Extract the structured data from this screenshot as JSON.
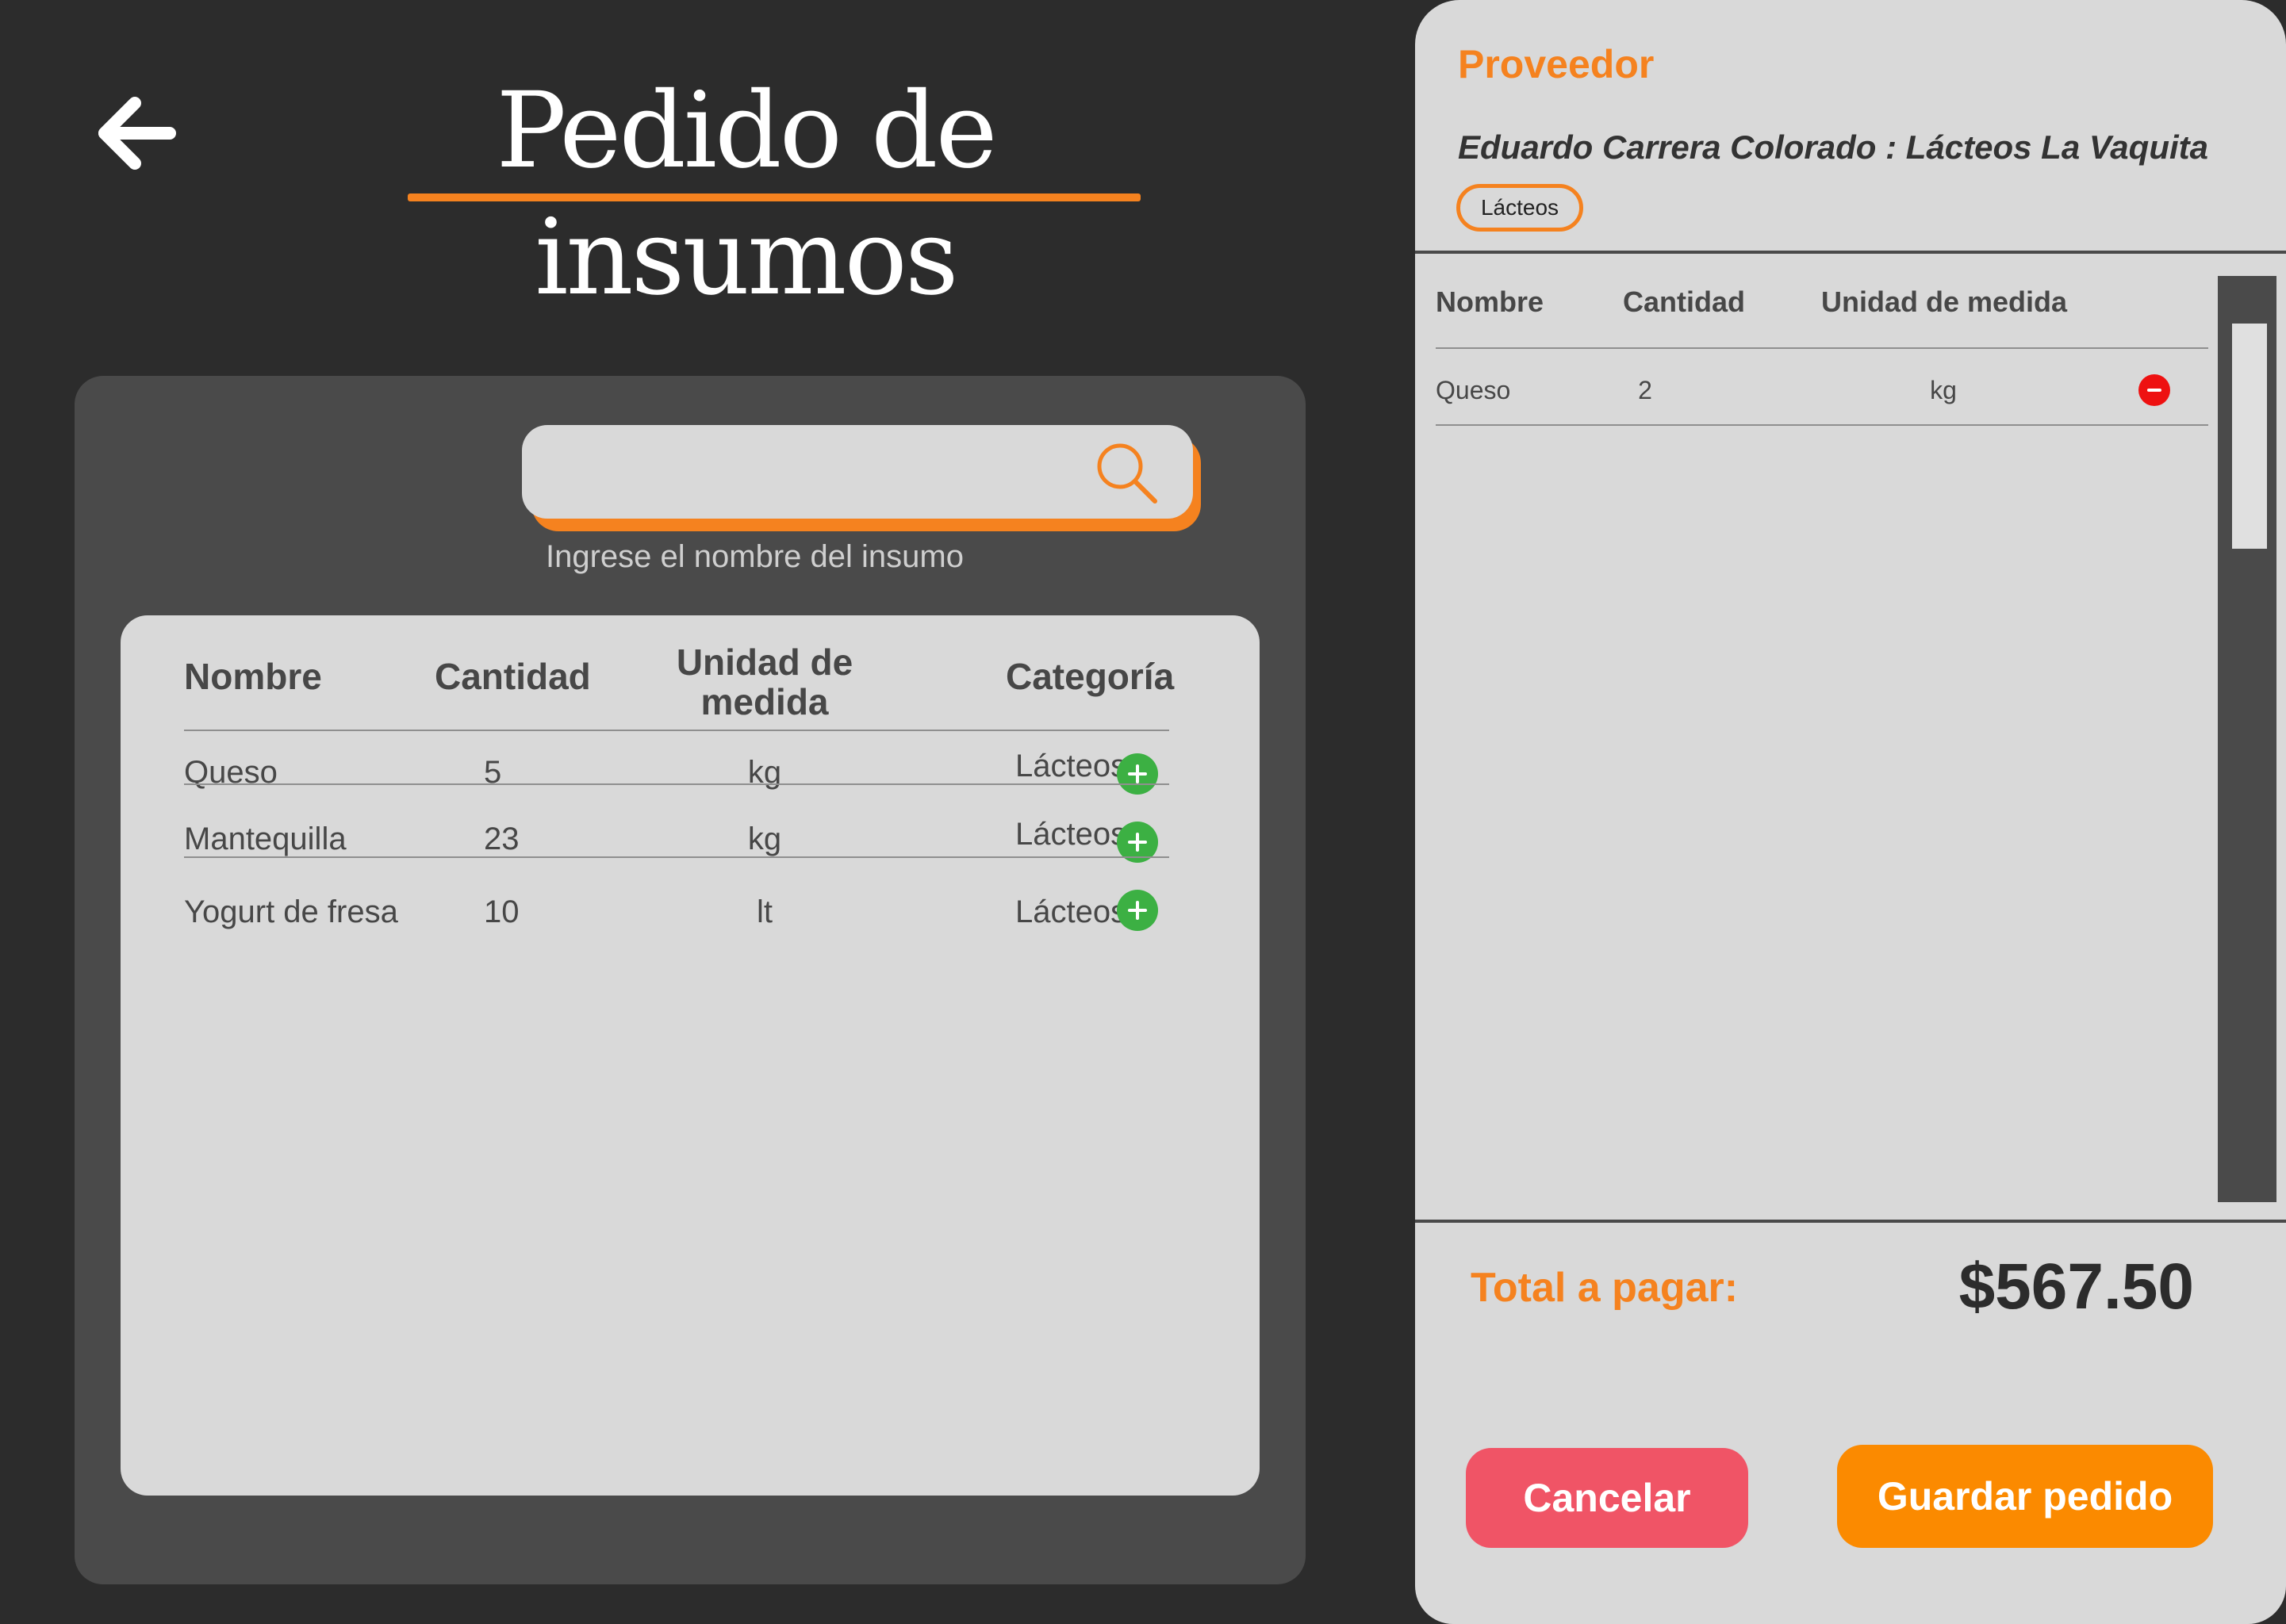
{
  "page": {
    "title": "Pedido de insumos"
  },
  "search": {
    "value": "",
    "placeholder": "",
    "hint": "Ingrese el nombre del insumo"
  },
  "inventory_table": {
    "headers": {
      "nombre": "Nombre",
      "cantidad": "Cantidad",
      "unidad_line1": "Unidad de",
      "unidad_line2": "medida",
      "categoria": "Categoría"
    },
    "rows": [
      {
        "nombre": "Queso",
        "cantidad": "5",
        "unidad": "kg",
        "categoria": "Lácteos"
      },
      {
        "nombre": "Mantequilla",
        "cantidad": "23",
        "unidad": "kg",
        "categoria": "Lácteos"
      },
      {
        "nombre": "Yogurt de fresa",
        "cantidad": "10",
        "unidad": "lt",
        "categoria": "Lácteos"
      }
    ]
  },
  "order_panel": {
    "provider_label": "Proveedor",
    "provider_name": "Eduardo Carrera Colorado : Lácteos La Vaquita",
    "provider_category": "Lácteos",
    "headers": {
      "nombre": "Nombre",
      "cantidad": "Cantidad",
      "unidad": "Unidad de medida"
    },
    "rows": [
      {
        "nombre": "Queso",
        "cantidad": "2",
        "unidad": "kg"
      }
    ],
    "total_label": "Total a pagar:",
    "total_value": "$567.50",
    "cancel_label": "Cancelar",
    "save_label": "Guardar pedido"
  },
  "colors": {
    "background": "#2c2c2c",
    "accent": "#f5821f",
    "panel": "#4a4a4a",
    "card": "#d9d9d9",
    "add": "#3cb043",
    "remove": "#ee1111",
    "cancel": "#f05466",
    "save": "#fb8a00"
  },
  "icons": {
    "back": "arrow-left-icon",
    "search": "search-icon",
    "add": "plus-circle-icon",
    "remove": "minus-circle-icon"
  }
}
